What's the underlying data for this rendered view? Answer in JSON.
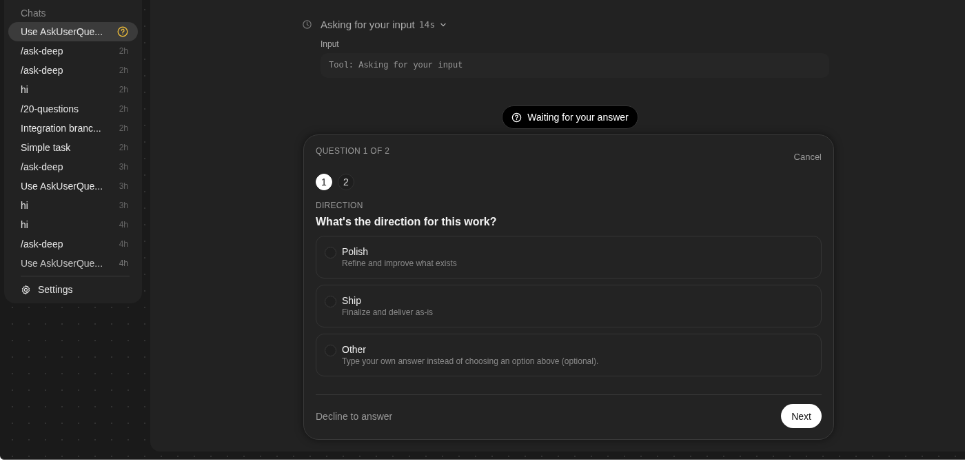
{
  "sidebar": {
    "heading": "Chats",
    "items": [
      {
        "title": "Use AskUserQue...",
        "awaiting": true,
        "selected": true
      },
      {
        "title": "/ask-deep",
        "time": "2h",
        "awaiting": false,
        "selected": false
      },
      {
        "title": "/ask-deep",
        "time": "2h",
        "awaiting": false,
        "selected": false
      },
      {
        "title": "hi",
        "time": "2h",
        "awaiting": false,
        "selected": false
      },
      {
        "title": "/20-questions",
        "time": "2h",
        "awaiting": false,
        "selected": false
      },
      {
        "title": "Integration branc...",
        "time": "2h",
        "awaiting": false,
        "selected": false
      },
      {
        "title": "Simple task",
        "time": "2h",
        "awaiting": false,
        "selected": false
      },
      {
        "title": "/ask-deep",
        "time": "3h",
        "awaiting": false,
        "selected": false
      },
      {
        "title": "Use AskUserQue...",
        "time": "3h",
        "awaiting": false,
        "selected": false
      },
      {
        "title": "hi",
        "time": "3h",
        "awaiting": false,
        "selected": false
      },
      {
        "title": "hi",
        "time": "4h",
        "awaiting": false,
        "selected": false
      },
      {
        "title": "/ask-deep",
        "time": "4h",
        "awaiting": false,
        "selected": false
      },
      {
        "title": "Use AskUserQue...",
        "time": "4h",
        "awaiting": false,
        "selected": false
      }
    ],
    "settings": "Settings"
  },
  "tool_call": {
    "title": "Asking for your input",
    "duration": "14s",
    "input_label": "Input",
    "input_value": "Tool: Asking for your input"
  },
  "status_pill": "Waiting for your answer",
  "question_card": {
    "progress": "QUESTION 1 OF 2",
    "cancel": "Cancel",
    "steps": [
      {
        "label": "1",
        "selected": true
      },
      {
        "label": "2",
        "selected": false
      }
    ],
    "header": "DIRECTION",
    "question": "What's the direction for this work?",
    "options": [
      {
        "label": "Polish",
        "description": "Refine and improve what exists",
        "selected": false
      },
      {
        "label": "Ship",
        "description": "Finalize and deliver as-is",
        "selected": false
      },
      {
        "label": "Other",
        "description": "Type your own answer instead of choosing an option above (optional).",
        "selected": false
      }
    ],
    "decline": "Decline to answer",
    "next": "Next"
  }
}
